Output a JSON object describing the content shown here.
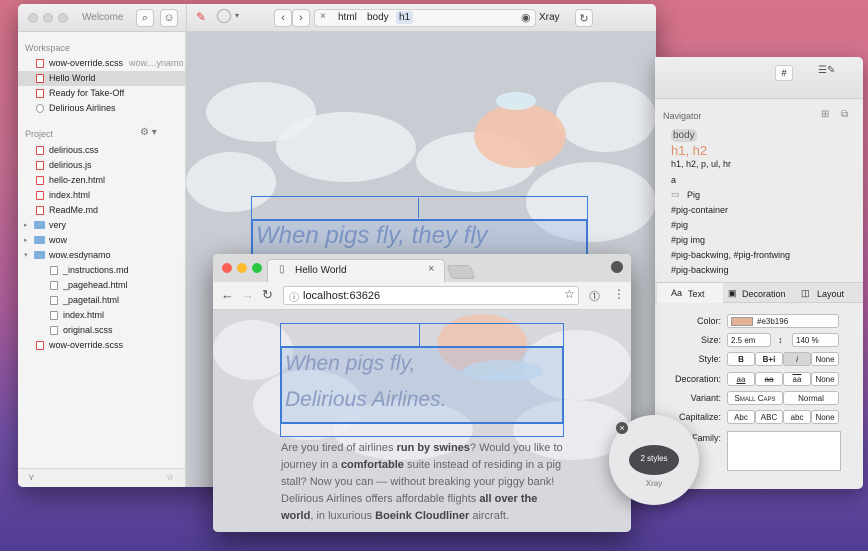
{
  "main_window": {
    "title": "Welcome",
    "toolbar": {
      "path": [
        "html",
        "body",
        "h1"
      ],
      "xray_label": "Xray"
    }
  },
  "sidebar": {
    "workspace_label": "Workspace",
    "workspace_items": [
      {
        "label": "wow-override.scss",
        "sub": "wow....ynamo"
      },
      {
        "label": "Hello World",
        "sub": ""
      },
      {
        "label": "Ready for Take-Off",
        "sub": ""
      },
      {
        "label": "Delirious Airlines",
        "sub": ""
      }
    ],
    "project_label": "Project",
    "project_items": [
      {
        "label": "delirious.css",
        "kind": "file"
      },
      {
        "label": "delirious.js",
        "kind": "file"
      },
      {
        "label": "hello-zen.html",
        "kind": "file"
      },
      {
        "label": "index.html",
        "kind": "file"
      },
      {
        "label": "ReadMe.md",
        "kind": "file"
      },
      {
        "label": "very",
        "kind": "folder"
      },
      {
        "label": "wow",
        "kind": "folder"
      },
      {
        "label": "wow.esdynamo",
        "kind": "folder"
      },
      {
        "label": "_instructions.md",
        "kind": "child"
      },
      {
        "label": "_pagehead.html",
        "kind": "child"
      },
      {
        "label": "_pagetail.html",
        "kind": "child"
      },
      {
        "label": "index.html",
        "kind": "child"
      },
      {
        "label": "original.scss",
        "kind": "child"
      },
      {
        "label": "wow-override.scss",
        "kind": "file"
      }
    ]
  },
  "canvas": {
    "headline": "When pigs fly, they fly"
  },
  "right_panel": {
    "navigator_title": "Navigator",
    "nav_items": [
      "body",
      "h1, h2",
      "h1, h2, p, ul, hr",
      "a",
      "Pig",
      "#pig-container",
      "#pig",
      "#pig img",
      "#pig-backwing, #pig-frontwing",
      "#pig-backwing"
    ],
    "tabs": [
      "Text",
      "Decoration",
      "Layout"
    ],
    "props": {
      "color_label": "Color:",
      "color_value": "#e3b196",
      "color_swatch": "#e3b196",
      "size_label": "Size:",
      "size_value": "2.5 em",
      "line_value": "140 %",
      "style_label": "Style:",
      "style_opts": [
        "B",
        "B+i",
        "i",
        "None"
      ],
      "decoration_label": "Decoration:",
      "decoration_opts": [
        "aa",
        "aa",
        "aa",
        "None"
      ],
      "variant_label": "Variant:",
      "variant_opts": [
        "Small Caps",
        "Normal"
      ],
      "capitalize_label": "Capitalize:",
      "capitalize_opts": [
        "Abc",
        "ABC",
        "abc",
        "None"
      ],
      "family_label": "Family:"
    }
  },
  "browser": {
    "tab_title": "Hello World",
    "url": "localhost:63626",
    "headline_1": "When pigs fly,",
    "headline_2": "Delirious Airlines.",
    "paragraph": [
      {
        "t": "Are you tired of airlines ",
        "b": false
      },
      {
        "t": "run by swines",
        "b": true
      },
      {
        "t": "? Would you like to journey in a ",
        "b": false
      },
      {
        "t": "comfortable",
        "b": true
      },
      {
        "t": " suite instead of residing in a pig stall? Now you can — without breaking your piggy bank! Delirious Airlines offers affordable flights ",
        "b": false
      },
      {
        "t": "all over the world",
        "b": true
      },
      {
        "t": ", in luxurious ",
        "b": false
      },
      {
        "t": "Boeink Cloudliner",
        "b": true
      },
      {
        "t": " aircraft.",
        "b": false
      }
    ]
  },
  "xray_bubble": {
    "styles_label": "2 styles",
    "name": "Xray"
  }
}
